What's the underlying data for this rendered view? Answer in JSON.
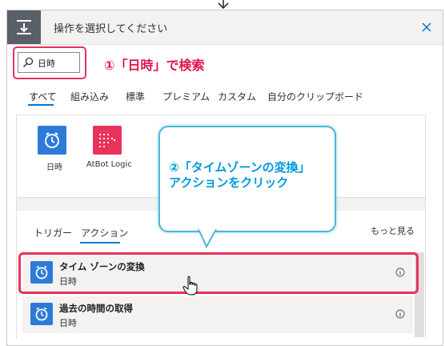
{
  "header": {
    "title": "操作を選択してください"
  },
  "search": {
    "value": "日時"
  },
  "annotations": {
    "step1": "①「日時」で検索",
    "step2_line1": "②「タイムゾーンの変換」",
    "step2_line2": "アクションをクリック"
  },
  "tabs": [
    {
      "label": "すべて",
      "active": true
    },
    {
      "label": "組み込み"
    },
    {
      "label": "標準"
    },
    {
      "label": "プレミアム"
    },
    {
      "label": "カスタム"
    },
    {
      "label": "自分のクリップボード"
    }
  ],
  "connectors": [
    {
      "label": "日時",
      "icon": "alarm-clock-icon",
      "color": "#2d7ad7"
    },
    {
      "label": "AtBot Logic",
      "icon": "atbot-logic-icon",
      "color": "#e8335d"
    }
  ],
  "subtabs": {
    "triggers": "トリガー",
    "actions": "アクション",
    "see_more": "もっと見る"
  },
  "actions": [
    {
      "title": "タイム ゾーンの変換",
      "subtitle": "日時",
      "icon": "alarm-clock-icon"
    },
    {
      "title": "過去の時間の取得",
      "subtitle": "日時",
      "icon": "alarm-clock-icon"
    }
  ],
  "colors": {
    "accent": "#0078d4",
    "highlight": "#e8335d",
    "callout_border": "#4bb6d8",
    "callout_text": "#0098e0",
    "annotation_text": "#e0144a"
  }
}
